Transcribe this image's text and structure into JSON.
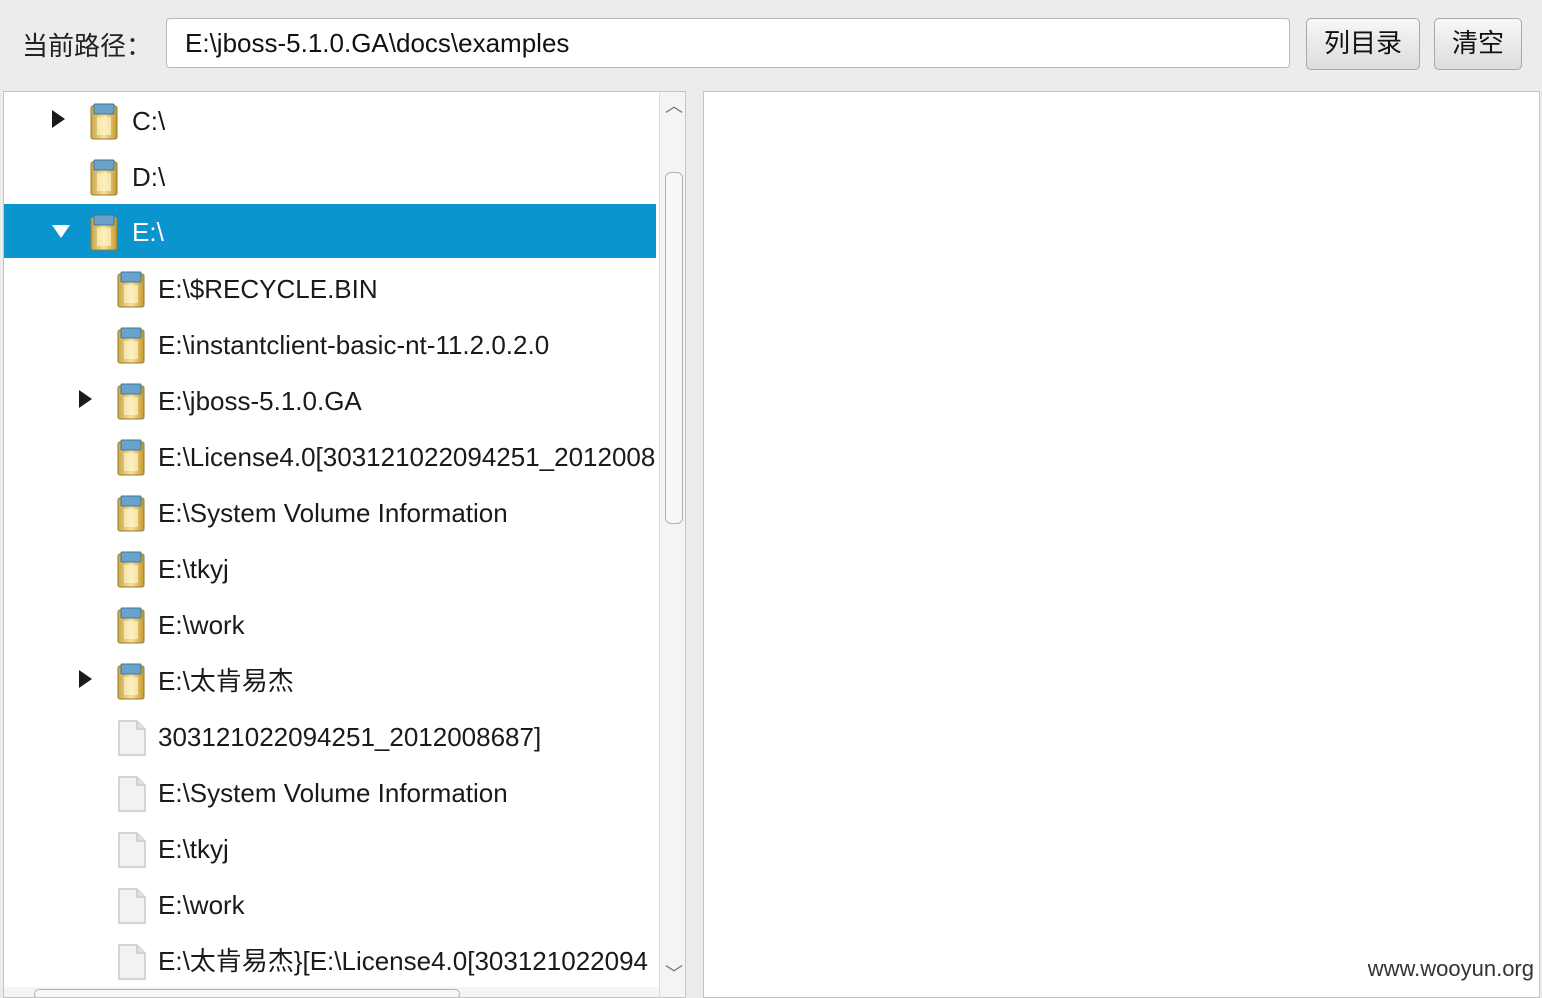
{
  "toolbar": {
    "path_label": "当前路径：",
    "path_value": "E:\\jboss-5.1.0.GA\\docs\\examples",
    "list_button": "列目录",
    "clear_button": "清空"
  },
  "tree": {
    "selection_color": "#0a95cf",
    "rows": [
      {
        "label": "C:\\",
        "icon": "drive-folder-icon",
        "toggle": "collapsed"
      },
      {
        "label": "D:\\",
        "icon": "drive-folder-icon",
        "toggle": "none"
      },
      {
        "label": "E:\\",
        "icon": "drive-folder-icon",
        "toggle": "expanded",
        "selected": true
      },
      {
        "label": "E:\\$RECYCLE.BIN",
        "icon": "folder-icon",
        "toggle": "none"
      },
      {
        "label": "E:\\instantclient-basic-nt-11.2.0.2.0",
        "icon": "folder-icon",
        "toggle": "none"
      },
      {
        "label": "E:\\jboss-5.1.0.GA",
        "icon": "folder-icon",
        "toggle": "collapsed"
      },
      {
        "label": "E:\\License4.0[303121022094251_2012008",
        "icon": "folder-icon",
        "toggle": "none"
      },
      {
        "label": "E:\\System Volume Information",
        "icon": "folder-icon",
        "toggle": "none"
      },
      {
        "label": "E:\\tkyj",
        "icon": "folder-icon",
        "toggle": "none"
      },
      {
        "label": "E:\\work",
        "icon": "folder-icon",
        "toggle": "none"
      },
      {
        "label": "E:\\太肯易杰",
        "icon": "folder-icon",
        "toggle": "collapsed"
      },
      {
        "label": "303121022094251_2012008687]",
        "icon": "file-icon",
        "toggle": "none"
      },
      {
        "label": "E:\\System Volume Information",
        "icon": "file-icon",
        "toggle": "none"
      },
      {
        "label": "E:\\tkyj",
        "icon": "file-icon",
        "toggle": "none"
      },
      {
        "label": "E:\\work",
        "icon": "file-icon",
        "toggle": "none"
      },
      {
        "label": "E:\\太肯易杰}[E:\\License4.0[303121022094",
        "icon": "file-icon",
        "toggle": "none"
      }
    ]
  },
  "watermark": "www.wooyun.org"
}
